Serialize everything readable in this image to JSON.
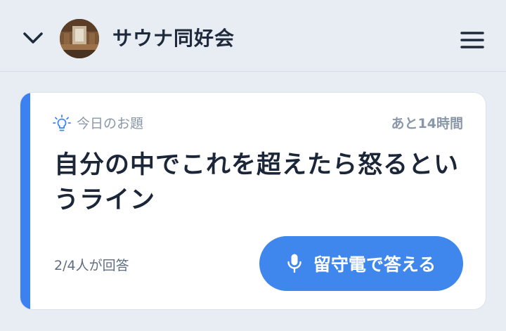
{
  "header": {
    "group_name": "サウナ同好会",
    "back_icon": "chevron-down-icon",
    "menu_icon": "hamburger-menu-icon",
    "avatar_image": "sauna-room-photo"
  },
  "topic_card": {
    "label_icon": "lightbulb-icon",
    "label": "今日のお題",
    "time_left": "あと14時間",
    "question": "自分の中でこれを超えたら怒るというライン",
    "answered_count": "2/4人が回答",
    "answer_button": {
      "icon": "microphone-icon",
      "label": "留守電で答える"
    }
  },
  "colors": {
    "background": "#e8edf4",
    "accent": "#3b82f0",
    "button": "#3f87ec",
    "muted_text": "#8a97a8",
    "primary_text": "#1b2638"
  }
}
